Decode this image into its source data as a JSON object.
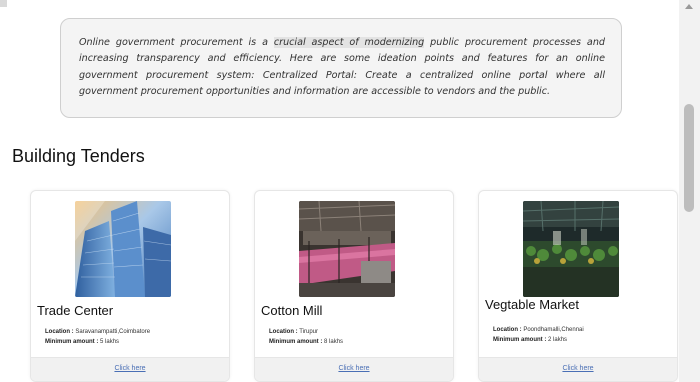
{
  "intro": {
    "before": "Online government procurement is a ",
    "highlight": "crucial aspect of modernizing",
    "after": " public procurement processes and increasing transparency and efficiency. Here are some ideation points and features for an online government procurement system: Centralized Portal: Create a centralized online portal where all government procurement opportunities and information are accessible to vendors and the public."
  },
  "section": {
    "title": "Building Tenders"
  },
  "labels": {
    "location": "Location :",
    "minimum_amount": "Minimum amount :"
  },
  "cards": [
    {
      "name": "Trade Center",
      "location": "Saravanampatti,Coimbatore",
      "amount": "5 lakhs",
      "link": "Click here",
      "image": "glass-skyscraper-image"
    },
    {
      "name": "Cotton Mill",
      "location": "Tirupur",
      "amount": "8 lakhs",
      "link": "Click here",
      "image": "textile-mill-image"
    },
    {
      "name": "Vegtable Market",
      "location": "Poondhamalli,Chennai",
      "amount": "2 lakhs",
      "link": "Click here",
      "image": "vegetable-market-image"
    }
  ]
}
